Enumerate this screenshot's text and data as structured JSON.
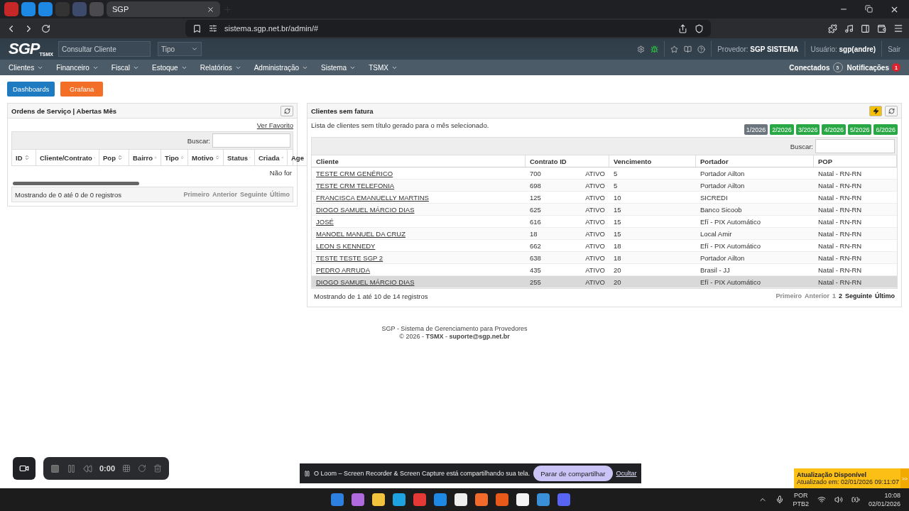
{
  "browser": {
    "tabs": [
      {
        "label": "SGP",
        "selected": true
      }
    ],
    "url": "sistema.sgp.net.br/admin/#"
  },
  "header": {
    "logo": "SGP",
    "logo_sub": "TSMX",
    "search": {
      "placeholder": "Consultar Cliente"
    },
    "type_select": "Tipo",
    "provider_label": "Provedor:",
    "provider": "SGP SISTEMA",
    "user_label": "Usuário:",
    "user": "sgp(andre)",
    "logout": "Sair"
  },
  "menu": [
    "Clientes",
    "Financeiro",
    "Fiscal",
    "Estoque",
    "Relatórios",
    "Administração",
    "Sistema",
    "TSMX"
  ],
  "status": [
    {
      "label": "Conectados",
      "count": "5",
      "kind": "neutral"
    },
    {
      "label": "Notificações",
      "count": "1",
      "kind": "alert"
    }
  ],
  "top_buttons": [
    {
      "label": "Dashboards",
      "kind": "primary"
    },
    {
      "label": "Grafana",
      "kind": "warning"
    }
  ],
  "orders_panel": {
    "title": "Ordens de Serviço | Abertas Mês",
    "link": "Ver Favorito",
    "search_label": "Buscar:",
    "columns": [
      "ID",
      "Cliente/Contrato",
      "Pop",
      "Bairro",
      "Tipo",
      "Motivo",
      "Status",
      "Criada",
      "Age"
    ],
    "empty": "Não for",
    "info": "Mostrando de 0 até 0 de 0 registros",
    "pager": [
      {
        "label": "Primeiro",
        "disabled": true
      },
      {
        "label": "Anterior",
        "disabled": true
      },
      {
        "label": "Seguinte",
        "disabled": true
      },
      {
        "label": "Último",
        "disabled": true
      }
    ]
  },
  "clients_panel": {
    "title": "Clientes sem fatura",
    "description": "Lista de clientes sem título gerado para o mês selecionado.",
    "months": [
      {
        "label": "1/2026",
        "selected": true
      },
      {
        "label": "2/2026",
        "selected": false
      },
      {
        "label": "3/2026",
        "selected": false
      },
      {
        "label": "4/2026",
        "selected": false
      },
      {
        "label": "5/2026",
        "selected": false
      },
      {
        "label": "6/2026",
        "selected": false
      }
    ],
    "search_label": "Buscar:",
    "columns": [
      "Cliente",
      "Contrato ID",
      "Vencimento",
      "Portador",
      "POP"
    ],
    "rows": [
      {
        "cliente": "TESTE CRM GENÉRICO",
        "contrato": "700",
        "status": "ATIVO",
        "vencimento": "5",
        "portador": "Portador Ailton",
        "pop": "Natal - RN-RN",
        "highlighted": false
      },
      {
        "cliente": "TESTE CRM TELEFONIA",
        "contrato": "698",
        "status": "ATIVO",
        "vencimento": "5",
        "portador": "Portador Ailton",
        "pop": "Natal - RN-RN",
        "highlighted": false
      },
      {
        "cliente": "FRANCISCA EMANUELLY MARTINS",
        "contrato": "125",
        "status": "ATIVO",
        "vencimento": "10",
        "portador": "SICREDI",
        "pop": "Natal - RN-RN",
        "highlighted": false
      },
      {
        "cliente": "DIOGO SAMUEL MÁRCIO DIAS",
        "contrato": "625",
        "status": "ATIVO",
        "vencimento": "15",
        "portador": "Banco Sicoob",
        "pop": "Natal - RN-RN",
        "highlighted": false
      },
      {
        "cliente": "JOSÉ",
        "contrato": "616",
        "status": "ATIVO",
        "vencimento": "15",
        "portador": "Efí - PIX Automático",
        "pop": "Natal - RN-RN",
        "highlighted": false
      },
      {
        "cliente": "MANOEL MANUEL DA CRUZ",
        "contrato": "18",
        "status": "ATIVO",
        "vencimento": "15",
        "portador": "Local Amir",
        "pop": "Natal - RN-RN",
        "highlighted": false
      },
      {
        "cliente": "LEON S KENNEDY",
        "contrato": "662",
        "status": "ATIVO",
        "vencimento": "18",
        "portador": "Efí - PIX Automático",
        "pop": "Natal - RN-RN",
        "highlighted": false
      },
      {
        "cliente": "TESTE TESTE SGP 2",
        "contrato": "638",
        "status": "ATIVO",
        "vencimento": "18",
        "portador": "Portador Ailton",
        "pop": "Natal - RN-RN",
        "highlighted": false
      },
      {
        "cliente": "PEDRO ARRUDA",
        "contrato": "435",
        "status": "ATIVO",
        "vencimento": "20",
        "portador": "Brasil - JJ",
        "pop": "Natal - RN-RN",
        "highlighted": false
      },
      {
        "cliente": "DIOGO SAMUEL MÁRCIO DIAS",
        "contrato": "255",
        "status": "ATIVO",
        "vencimento": "20",
        "portador": "Efí - PIX Automático",
        "pop": "Natal - RN-RN",
        "highlighted": true
      }
    ],
    "info": "Mostrando de 1 até 10 de 14 registros",
    "pager": [
      {
        "label": "Primeiro",
        "disabled": true
      },
      {
        "label": "Anterior",
        "disabled": true
      },
      {
        "label": "1",
        "disabled": true
      },
      {
        "label": "2",
        "disabled": false
      },
      {
        "label": "Seguinte",
        "disabled": false
      },
      {
        "label": "Último",
        "disabled": false
      }
    ]
  },
  "footer": [
    "SGP - Sistema de Gerenciamento para Provedores",
    "© 2026 - **TSMX** - **suporte@sgp.net.br**"
  ],
  "recorder": {
    "time": "0:00"
  },
  "share_banner": {
    "text": "O Loom – Screen Recorder & Screen Capture está compartilhando sua tela.",
    "button": "Parar de compartilhar",
    "link": "Ocultar"
  },
  "update_toast": {
    "title": "Atualização Disponível",
    "subtitle": "Atualizado em: 02/01/2026 09:11:07",
    "toggle": ">>"
  },
  "taskbar": {
    "lang": "POR",
    "layout": "PTB2",
    "time": "10:08",
    "date": "02/01/2026"
  }
}
